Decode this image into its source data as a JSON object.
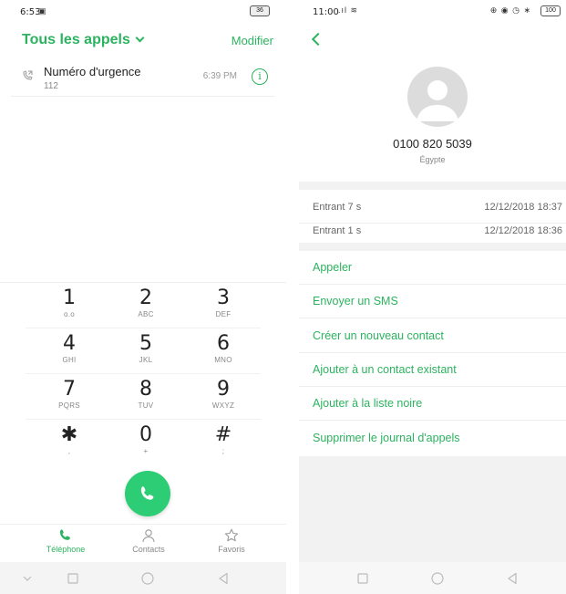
{
  "left": {
    "status": {
      "time": "6:53",
      "battery": "36"
    },
    "header": {
      "title": "Tous les appels",
      "edit": "Modifier"
    },
    "call_log": [
      {
        "name": "Numéro d'urgence",
        "number": "112",
        "time": "6:39 PM"
      }
    ],
    "dialpad": [
      {
        "digit": "1",
        "letters": "ᴏ.ᴏ"
      },
      {
        "digit": "2",
        "letters": "ABC"
      },
      {
        "digit": "3",
        "letters": "DEF"
      },
      {
        "digit": "4",
        "letters": "GHI"
      },
      {
        "digit": "5",
        "letters": "JKL"
      },
      {
        "digit": "6",
        "letters": "MNO"
      },
      {
        "digit": "7",
        "letters": "PQRS"
      },
      {
        "digit": "8",
        "letters": "TUV"
      },
      {
        "digit": "9",
        "letters": "WXYZ"
      },
      {
        "digit": "✱",
        "letters": ","
      },
      {
        "digit": "0",
        "letters": "+"
      },
      {
        "digit": "#",
        "letters": ";"
      }
    ],
    "tabs": [
      {
        "label": "Téléphone",
        "icon": "phone-icon",
        "active": true
      },
      {
        "label": "Contacts",
        "icon": "person-icon",
        "active": false
      },
      {
        "label": "Favoris",
        "icon": "star-icon",
        "active": false
      }
    ]
  },
  "right": {
    "status": {
      "time": "11:00",
      "battery": "100"
    },
    "contact": {
      "number": "0100 820 5039",
      "country": "Égypte"
    },
    "log": [
      {
        "type": "Entrant  7 s",
        "date": "12/12/2018 18:37"
      },
      {
        "type": "Entrant  1 s",
        "date": "12/12/2018 18:36"
      }
    ],
    "actions": [
      "Appeler",
      "Envoyer un SMS",
      "Créer un nouveau contact",
      "Ajouter à un contact existant",
      "Ajouter à la liste noire",
      "Supprimer le journal d'appels"
    ]
  },
  "colors": {
    "accent": "#2cb35f",
    "call_button": "#2ccd75",
    "nav_bar": "#f4f4f4"
  }
}
